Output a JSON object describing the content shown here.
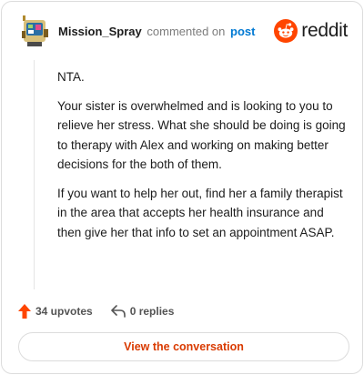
{
  "comment": {
    "username": "Mission_Spray",
    "action_text": "commented on",
    "post_link": "post",
    "paragraphs": [
      "NTA.",
      "Your sister is overwhelmed and is looking to you to relieve her stress. What she should be doing is going to therapy with Alex and working on making better decisions for the both of them.",
      "If you want to help her out, find her a family therapist in the area that accepts her health insurance and then give her that info to set an appointment ASAP."
    ],
    "upvotes": "34 upvotes",
    "replies": "0 replies"
  },
  "brand": {
    "name": "reddit",
    "color": "#ff4500"
  },
  "cta": {
    "label": "View the conversation"
  },
  "icons": {
    "avatar": "snoo-avatar-icon",
    "brand": "reddit-logo-icon",
    "upvote": "upvote-arrow-icon",
    "reply": "reply-arrow-icon"
  }
}
